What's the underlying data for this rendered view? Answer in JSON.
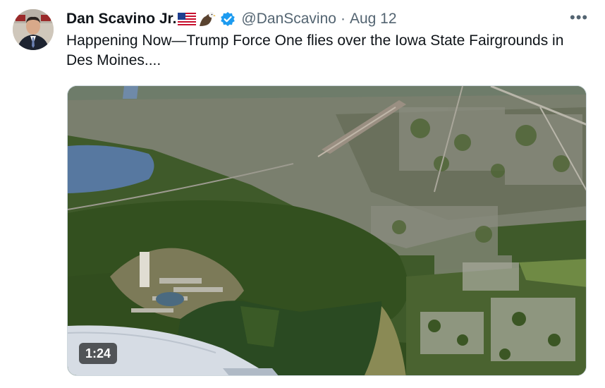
{
  "tweet": {
    "author_name": "Dan Scavino Jr.",
    "handle": "@DanScavino",
    "separator": "·",
    "date": "Aug 12",
    "text": "Happening Now—Trump Force One flies over the Iowa State Fairgrounds in Des Moines....",
    "more_menu": "•••",
    "name_emojis": [
      "us-flag-icon",
      "eagle-icon"
    ],
    "verified_color": "#1d9bf0"
  },
  "media": {
    "type": "video",
    "duration": "1:24"
  },
  "colors": {
    "text": "#0f1419",
    "secondary": "#536471",
    "accent": "#1d9bf0"
  }
}
